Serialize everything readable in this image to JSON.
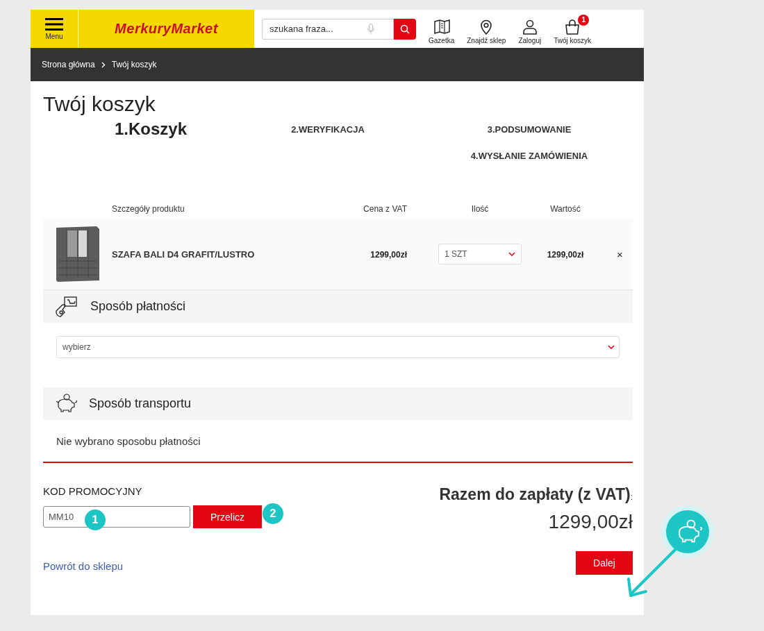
{
  "header": {
    "menu_label": "Menu",
    "logo": "MerkuryMarket",
    "search": {
      "placeholder": "szukana fraza..."
    },
    "nav": [
      {
        "kind": "flyer",
        "label": "Gazetka"
      },
      {
        "kind": "store",
        "label": "Znajdź sklep"
      },
      {
        "kind": "account",
        "label": "Zaloguj"
      },
      {
        "kind": "cart",
        "label": "Twój koszyk",
        "badge": "1"
      }
    ]
  },
  "breadcrumb": [
    "Strona główna",
    "Twój koszyk"
  ],
  "title": "Twój koszyk",
  "steps": [
    {
      "label": "1.Koszyk",
      "selected": true
    },
    {
      "label": "2.WERYFIKACJA",
      "selected": false
    },
    {
      "label": "3.PODSUMOWANIE",
      "selected": false
    },
    {
      "label": "4.WYSŁANIE ZAMÓWIENIA",
      "selected": false
    }
  ],
  "cart": {
    "columns": [
      "Szczegóły produktu",
      "Cena z VAT",
      "Ilość",
      "Wartość"
    ],
    "rows": [
      {
        "name": "SZAFA BALI D4 GRAFIT/LUSTRO",
        "price": "1299,00zł",
        "quantity": "1 SZT",
        "value": "1299,00zł",
        "remove": "×"
      }
    ]
  },
  "payment": {
    "title": "Sposób płatności",
    "select": "wybierz"
  },
  "transport": {
    "title": "Sposób transportu",
    "message": "Nie wybrano sposobu płatności"
  },
  "promo": {
    "label": "KOD PROMOCYJNY",
    "value": "MM10",
    "button": "Przelicz"
  },
  "total": {
    "label": "Razem do zapłaty (z VAT)",
    "colon": ":",
    "amount": "1299,00zł"
  },
  "back_link": "Powrót do sklepu",
  "next_button": "Dalej",
  "annotations": [
    "1",
    "2"
  ]
}
